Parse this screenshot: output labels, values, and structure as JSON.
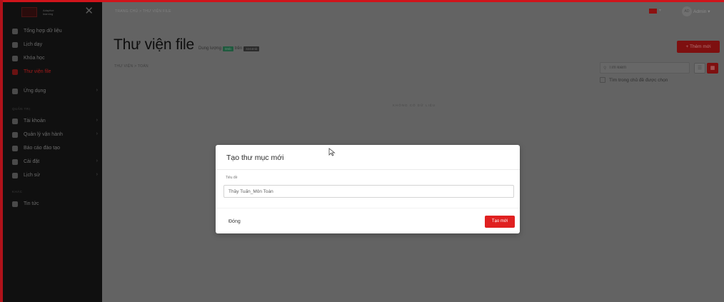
{
  "brand": {
    "logo_text": "Adaptive learning",
    "accent": "#e02020"
  },
  "sidebar": {
    "items": [
      {
        "label": "Tổng hợp dữ liệu",
        "icon": "grid-icon"
      },
      {
        "label": "Lịch dạy",
        "icon": "video-icon"
      },
      {
        "label": "Khóa học",
        "icon": "book-icon"
      },
      {
        "label": "Thư viện file",
        "icon": "folder-icon",
        "active": true
      },
      {
        "label": "Ứng dụng",
        "icon": "app-icon"
      }
    ],
    "section_admin": "QUẢN TRỊ",
    "admin_items": [
      {
        "label": "Tài khoản",
        "icon": "users-icon"
      },
      {
        "label": "Quản lý vận hành",
        "icon": "clipboard-icon"
      },
      {
        "label": "Báo cáo đào tạo",
        "icon": "report-icon"
      },
      {
        "label": "Cài đặt",
        "icon": "gear-icon"
      },
      {
        "label": "Lịch sử",
        "icon": "history-icon"
      }
    ],
    "section_other": "KHÁC",
    "other_items": [
      {
        "label": "Tin tức",
        "icon": "news-icon"
      }
    ]
  },
  "topbar": {
    "breadcrumb": "TRANG CHỦ > THƯ VIỆN FILE",
    "avatar_initials": "AD",
    "user_name": "Admin"
  },
  "main": {
    "title": "Thư viện file",
    "storage_label": "Dung lượng",
    "storage_used": "0mb",
    "storage_sep": "trên",
    "storage_total": "3244mb",
    "add_button": "+ Thêm mới",
    "breadcrumb": "THƯ VIỆN > TOÁN",
    "search_placeholder": "Tìm kiếm",
    "scope_label": "Tìm trong chủ đề được chọn",
    "empty_text": "KHÔNG CÓ DỮ LIỆU"
  },
  "modal": {
    "title": "Tạo thư mục mới",
    "field_label": "Tiêu đề",
    "field_value": "Thầy Tuấn_Môn Toán",
    "close_button": "Đóng",
    "create_button": "Tạo mới"
  }
}
